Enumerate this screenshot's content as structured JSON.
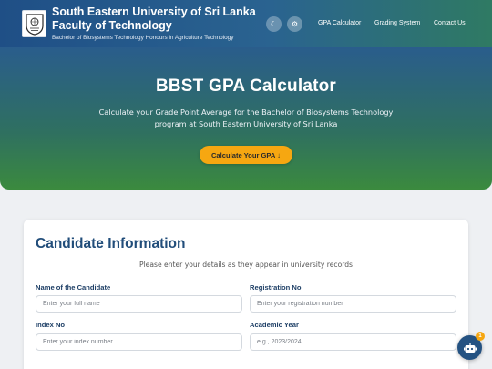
{
  "header": {
    "university": "South Eastern University of Sri Lanka",
    "faculty": "Faculty of Technology",
    "degree": "Bachelor of Biosystems Technology Honours in Agriculture Technology",
    "theme_toggle_icon": "moon-icon",
    "settings_icon": "gear-icon",
    "nav": [
      "GPA Calculator",
      "Grading System",
      "Contact Us"
    ]
  },
  "hero": {
    "title": "BBST GPA Calculator",
    "subtitle": "Calculate your Grade Point Average for the Bachelor of Biosystems Technology program at South Eastern University of Sri Lanka",
    "cta_label": "Calculate Your GPA ↓"
  },
  "candidate": {
    "title": "Candidate Information",
    "note": "Please enter your details as they appear in university records",
    "fields": {
      "name": {
        "label": "Name of the Candidate",
        "placeholder": "Enter your full name",
        "value": ""
      },
      "registration": {
        "label": "Registration No",
        "placeholder": "Enter your registration number",
        "value": ""
      },
      "index": {
        "label": "Index No",
        "placeholder": "Enter your index number",
        "value": ""
      },
      "year": {
        "label": "Academic Year",
        "placeholder": "e.g., 2023/2024",
        "value": ""
      }
    }
  },
  "chat": {
    "icon": "chatbot-icon",
    "badge": "1"
  },
  "colors": {
    "primary": "#214d7a",
    "accent": "#f6a711",
    "hero_green": "#3b8a3e"
  }
}
